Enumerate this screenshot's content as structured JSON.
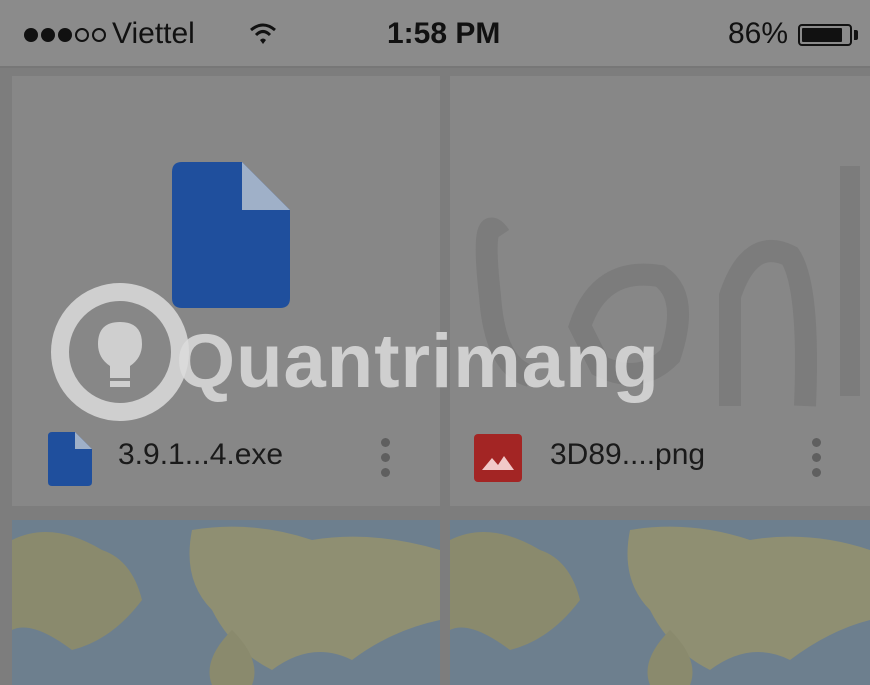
{
  "status_bar": {
    "signal_dots": [
      true,
      true,
      true,
      false,
      false
    ],
    "carrier": "Viettel",
    "time": "1:58 PM",
    "battery_percent": "86%",
    "battery_level": 0.86
  },
  "files": [
    {
      "name": "3.9.1...4.exe",
      "icon": "document-icon",
      "icon_color": "#1f4f9d"
    },
    {
      "name": "3D89....png",
      "icon": "image-icon",
      "icon_color": "#a32524"
    }
  ],
  "watermark": {
    "text": "Quantrimang"
  },
  "colors": {
    "doc_blue": "#1f4f9d",
    "img_red": "#a32524"
  }
}
